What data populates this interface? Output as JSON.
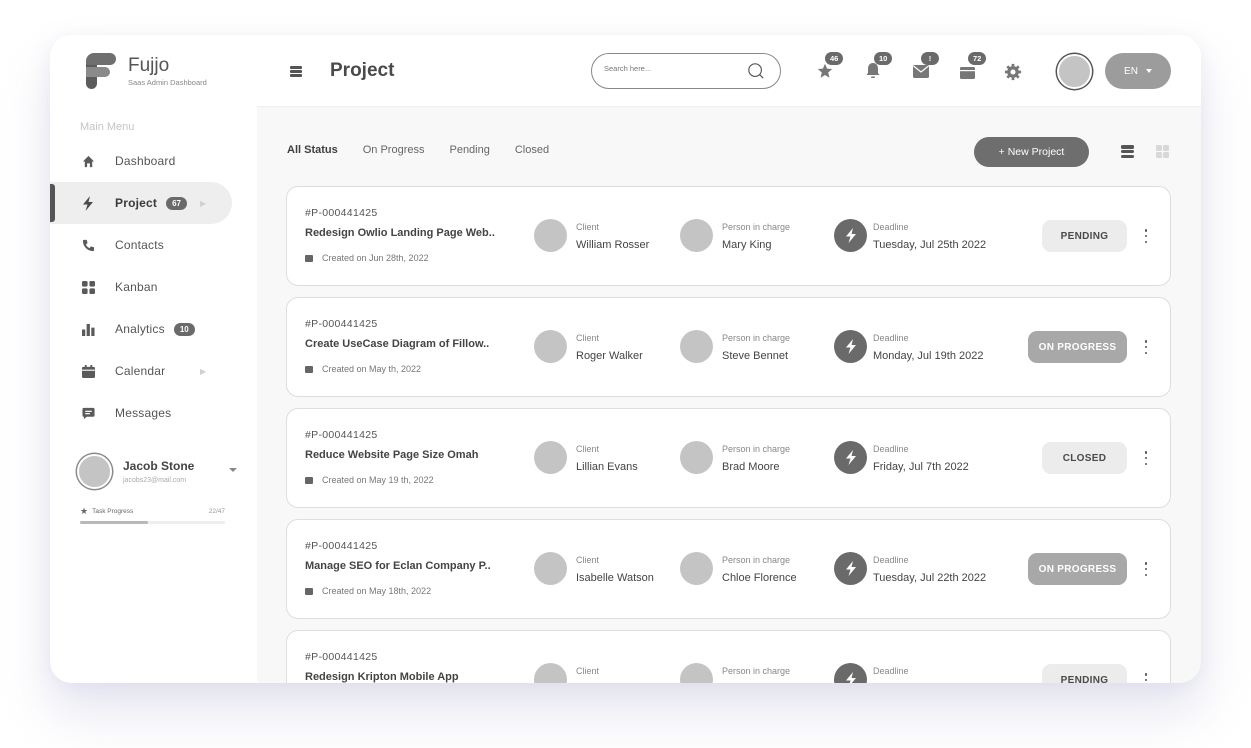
{
  "brand": {
    "name": "Fujjo",
    "subtitle": "Saas Admin Dashboard"
  },
  "sidebar": {
    "menu_title": "Main Menu",
    "items": [
      {
        "label": "Dashboard",
        "icon": "home-icon"
      },
      {
        "label": "Project",
        "icon": "bolt-icon",
        "badge": "67",
        "active": true,
        "has_chevron": true
      },
      {
        "label": "Contacts",
        "icon": "phone-icon"
      },
      {
        "label": "Kanban",
        "icon": "grid-icon"
      },
      {
        "label": "Analytics",
        "icon": "bar-chart-icon",
        "badge": "10"
      },
      {
        "label": "Calendar",
        "icon": "calendar-icon",
        "has_chevron": true
      },
      {
        "label": "Messages",
        "icon": "message-icon"
      }
    ],
    "user": {
      "name": "Jacob Stone",
      "email": "jacobs23@mail.com"
    },
    "task_progress": {
      "label": "Task Progress",
      "count": "22/47",
      "done": 22,
      "total": 47
    }
  },
  "header": {
    "title": "Project",
    "search_placeholder": "Search here...",
    "notifications": [
      {
        "icon": "star-icon",
        "badge": "46"
      },
      {
        "icon": "bell-icon",
        "badge": "10"
      },
      {
        "icon": "mail-icon",
        "badge": "!"
      },
      {
        "icon": "gift-icon",
        "badge": "72"
      }
    ],
    "language": "EN"
  },
  "toolbar": {
    "tabs": [
      "All Status",
      "On Progress",
      "Pending",
      "Closed"
    ],
    "active_tab": "All Status",
    "new_project_label": "+ New Project"
  },
  "labels": {
    "client": "Client",
    "person_in_charge": "Person in charge",
    "deadline": "Deadline"
  },
  "projects": [
    {
      "id": "#P-000441425",
      "title": "Redesign Owlio Landing Page Web..",
      "created": "Created on Jun 28th, 2022",
      "client": "William  Rosser",
      "pic": "Mary King",
      "deadline": "Tuesday,  Jul 25th 2022",
      "status": "PENDING",
      "status_class": "pending"
    },
    {
      "id": "#P-000441425",
      "title": "Create UseCase Diagram of Fillow..",
      "created": "Created on May  th, 2022",
      "client": "Roger Walker",
      "pic": "Steve Bennet",
      "deadline": "Monday,  Jul 19th 2022",
      "status": "ON PROGRESS",
      "status_class": "on-progress"
    },
    {
      "id": "#P-000441425",
      "title": "Reduce Website Page Size Omah",
      "created": "Created on May 19 th, 2022",
      "client": "Lillian Evans",
      "pic": "Brad Moore",
      "deadline": "Friday,  Jul 7th 2022",
      "status": "CLOSED",
      "status_class": "closed"
    },
    {
      "id": "#P-000441425",
      "title": "Manage SEO for Eclan Company P..",
      "created": "Created on May 18th, 2022",
      "client": "Isabelle Watson",
      "pic": "Chloe Florence",
      "deadline": "Tuesday,  Jul 22th 2022",
      "status": "ON PROGRESS",
      "status_class": "on-progress"
    },
    {
      "id": "#P-000441425",
      "title": "Redesign Kripton Mobile App",
      "created": "",
      "client": "",
      "pic": "",
      "deadline": "",
      "status": "PENDING",
      "status_class": "pending"
    }
  ]
}
